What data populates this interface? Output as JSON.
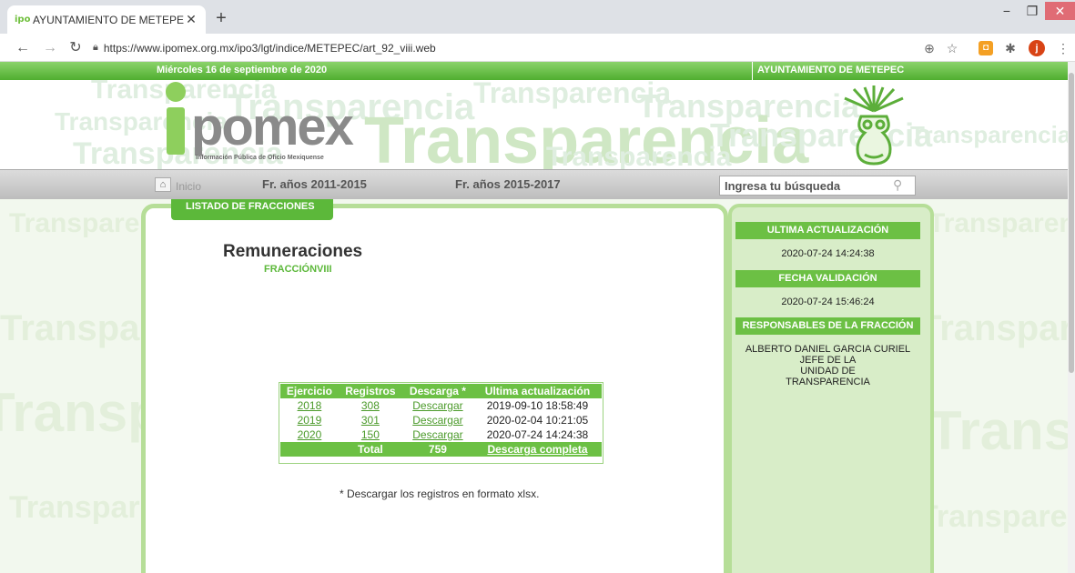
{
  "browser": {
    "tab_title": "AYUNTAMIENTO DE METEPEC - I",
    "favicon_text": "ipo",
    "url": "https://www.ipomex.org.mx/ipo3/lgt/indice/METEPEC/art_92_viii.web",
    "avatar_letter": "j"
  },
  "header": {
    "date": "Miércoles 16 de septiembre de 2020",
    "organization": "AYUNTAMIENTO DE METEPEC",
    "logo_word": "pomex",
    "logo_subtitle": "Información Pública de Oficio Mexiquense",
    "watermark": "Transparencia"
  },
  "nav": {
    "home": "Inicio",
    "link1": "Fr. años 2011-2015",
    "link2": "Fr. años 2015-2017",
    "search_placeholder": "Ingresa tu búsqueda"
  },
  "main": {
    "tab_label": "LISTADO DE FRACCIONES",
    "title": "Remuneraciones",
    "fraction": "FRACCIÓNVIII",
    "table": {
      "headers": [
        "Ejercicio",
        "Registros",
        "Descarga *",
        "Ultima actualización"
      ],
      "rows": [
        {
          "year": "2018",
          "count": "308",
          "download": "Descargar",
          "updated": "2019-09-10 18:58:49"
        },
        {
          "year": "2019",
          "count": "301",
          "download": "Descargar",
          "updated": "2020-02-04 10:21:05"
        },
        {
          "year": "2020",
          "count": "150",
          "download": "Descargar",
          "updated": "2020-07-24 14:24:38"
        }
      ],
      "total_label": "Total",
      "total_count": "759",
      "full_download": "Descarga completa"
    },
    "note": "* Descargar los registros en formato xlsx."
  },
  "sidebar": {
    "last_update_label": "ULTIMA ACTUALIZACIÓN",
    "last_update_value": "2020-07-24 14:24:38",
    "validation_label": "FECHA VALIDACIÓN",
    "validation_value": "2020-07-24 15:46:24",
    "responsible_label": "RESPONSABLES DE LA FRACCIÓN",
    "responsible_name": "ALBERTO DANIEL GARCIA CURIEL",
    "responsible_role": "JEFE DE LA UNIDAD DE TRANSPARENCIA"
  },
  "colors": {
    "accent_green": "#6cc044",
    "light_green": "#b6de98",
    "link_green": "#4b9a2a"
  }
}
